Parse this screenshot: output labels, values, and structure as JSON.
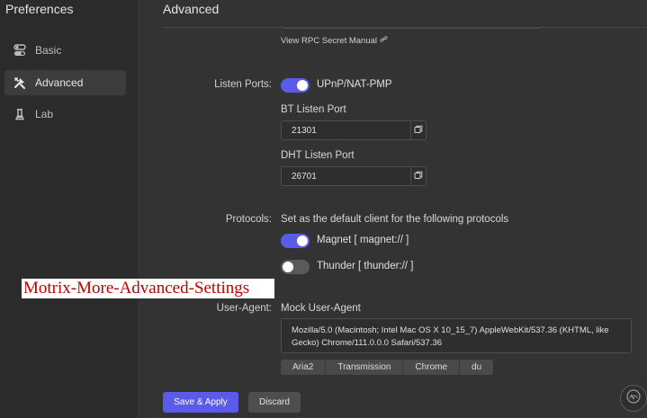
{
  "sidebar": {
    "title": "Preferences",
    "items": [
      {
        "label": "Basic",
        "icon": "toggles-icon",
        "active": false
      },
      {
        "label": "Advanced",
        "icon": "tools-icon",
        "active": true
      },
      {
        "label": "Lab",
        "icon": "flask-icon",
        "active": false
      }
    ]
  },
  "main": {
    "title": "Advanced",
    "rpc_manual_link": "View RPC Secret Manual",
    "listen_ports": {
      "label": "Listen Ports:",
      "upnp_label": "UPnP/NAT-PMP",
      "upnp_enabled": true,
      "bt_label": "BT Listen Port",
      "bt_value": "21301",
      "dht_label": "DHT Listen Port",
      "dht_value": "26701"
    },
    "protocols": {
      "label": "Protocols:",
      "description": "Set as the default client for the following protocols",
      "magnet_label": "Magnet [ magnet:// ]",
      "magnet_enabled": true,
      "thunder_label": "Thunder [ thunder:// ]",
      "thunder_enabled": false
    },
    "user_agent": {
      "label": "User-Agent:",
      "mock_label": "Mock User-Agent",
      "value": "Mozilla/5.0 (Macintosh; Intel Mac OS X 10_15_7) AppleWebKit/537.36 (KHTML, like Gecko) Chrome/111.0.0.0 Safari/537.36",
      "presets": [
        "Aria2",
        "Transmission",
        "Chrome",
        "du"
      ]
    }
  },
  "footer": {
    "save_label": "Save & Apply",
    "discard_label": "Discard"
  },
  "watermark": "Motrix-More-Advanced-Settings",
  "colors": {
    "accent": "#5b5bea",
    "background": "#333333",
    "sidebar": "#2b2b2b",
    "watermark_text": "#c00000"
  }
}
